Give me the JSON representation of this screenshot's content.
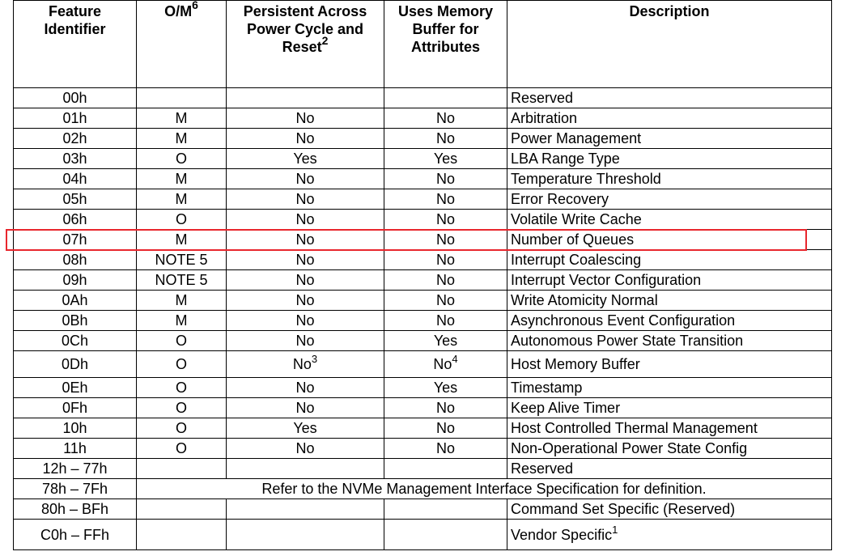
{
  "header": {
    "feature_identifier": "Feature Identifier",
    "om_label": "O/M",
    "om_sup": "6",
    "persistent_label": "Persistent Across Power Cycle and Reset",
    "persistent_sup": "2",
    "uses_memory_label": "Uses Memory Buffer for Attributes",
    "description_label": "Description"
  },
  "rows": [
    {
      "id": "00h",
      "om": "",
      "persist": "",
      "persist_sup": "",
      "mem": "",
      "mem_sup": "",
      "desc": "Reserved",
      "desc_sup": ""
    },
    {
      "id": "01h",
      "om": "M",
      "persist": "No",
      "persist_sup": "",
      "mem": "No",
      "mem_sup": "",
      "desc": "Arbitration",
      "desc_sup": ""
    },
    {
      "id": "02h",
      "om": "M",
      "persist": "No",
      "persist_sup": "",
      "mem": "No",
      "mem_sup": "",
      "desc": "Power Management",
      "desc_sup": ""
    },
    {
      "id": "03h",
      "om": "O",
      "persist": "Yes",
      "persist_sup": "",
      "mem": "Yes",
      "mem_sup": "",
      "desc": "LBA Range Type",
      "desc_sup": ""
    },
    {
      "id": "04h",
      "om": "M",
      "persist": "No",
      "persist_sup": "",
      "mem": "No",
      "mem_sup": "",
      "desc": "Temperature Threshold",
      "desc_sup": ""
    },
    {
      "id": "05h",
      "om": "M",
      "persist": "No",
      "persist_sup": "",
      "mem": "No",
      "mem_sup": "",
      "desc": "Error Recovery",
      "desc_sup": ""
    },
    {
      "id": "06h",
      "om": "O",
      "persist": "No",
      "persist_sup": "",
      "mem": "No",
      "mem_sup": "",
      "desc": "Volatile Write Cache",
      "desc_sup": ""
    },
    {
      "id": "07h",
      "om": "M",
      "persist": "No",
      "persist_sup": "",
      "mem": "No",
      "mem_sup": "",
      "desc": "Number of Queues",
      "desc_sup": ""
    },
    {
      "id": "08h",
      "om": "NOTE 5",
      "persist": "No",
      "persist_sup": "",
      "mem": "No",
      "mem_sup": "",
      "desc": "Interrupt Coalescing",
      "desc_sup": ""
    },
    {
      "id": "09h",
      "om": "NOTE 5",
      "persist": "No",
      "persist_sup": "",
      "mem": "No",
      "mem_sup": "",
      "desc": "Interrupt Vector Configuration",
      "desc_sup": ""
    },
    {
      "id": "0Ah",
      "om": "M",
      "persist": "No",
      "persist_sup": "",
      "mem": "No",
      "mem_sup": "",
      "desc": "Write Atomicity Normal",
      "desc_sup": ""
    },
    {
      "id": "0Bh",
      "om": "M",
      "persist": "No",
      "persist_sup": "",
      "mem": "No",
      "mem_sup": "",
      "desc": "Asynchronous Event Configuration",
      "desc_sup": ""
    },
    {
      "id": "0Ch",
      "om": "O",
      "persist": "No",
      "persist_sup": "",
      "mem": "Yes",
      "mem_sup": "",
      "desc": "Autonomous Power State Transition",
      "desc_sup": ""
    },
    {
      "id": "0Dh",
      "om": "O",
      "persist": "No",
      "persist_sup": "3",
      "mem": "No",
      "mem_sup": "4",
      "desc": "Host Memory Buffer",
      "desc_sup": ""
    },
    {
      "id": "0Eh",
      "om": "O",
      "persist": "No",
      "persist_sup": "",
      "mem": "Yes",
      "mem_sup": "",
      "desc": "Timestamp",
      "desc_sup": ""
    },
    {
      "id": "0Fh",
      "om": "O",
      "persist": "No",
      "persist_sup": "",
      "mem": "No",
      "mem_sup": "",
      "desc": "Keep Alive Timer",
      "desc_sup": ""
    },
    {
      "id": "10h",
      "om": "O",
      "persist": "Yes",
      "persist_sup": "",
      "mem": "No",
      "mem_sup": "",
      "desc": "Host Controlled Thermal Management",
      "desc_sup": ""
    },
    {
      "id": "11h",
      "om": "O",
      "persist": "No",
      "persist_sup": "",
      "mem": "No",
      "mem_sup": "",
      "desc": "Non-Operational Power State Config",
      "desc_sup": ""
    },
    {
      "id": "12h – 77h",
      "om": "",
      "persist": "",
      "persist_sup": "",
      "mem": "",
      "mem_sup": "",
      "desc": "Reserved",
      "desc_sup": ""
    }
  ],
  "refer_row": {
    "id": "78h – 7Fh",
    "text": "Refer to the NVMe Management Interface Specification for definition."
  },
  "tail_rows": [
    {
      "id": "80h – BFh",
      "desc": "Command Set Specific (Reserved)",
      "desc_sup": ""
    },
    {
      "id": "C0h – FFh",
      "desc": "Vendor Specific",
      "desc_sup": "1"
    }
  ],
  "highlight": {
    "row_id": "07h",
    "color": "#e8262d"
  }
}
